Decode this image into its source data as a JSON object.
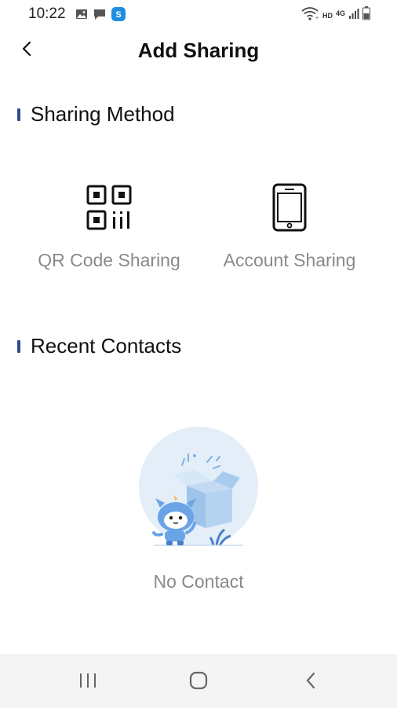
{
  "status_bar": {
    "time": "10:22",
    "left_icons": [
      "gallery-icon",
      "message-icon",
      "app-notification-icon"
    ],
    "right_icons": [
      "wifi-icon",
      "hd-icon",
      "signal-4g-icon",
      "battery-icon"
    ],
    "hd_label": "HD",
    "network_label": "4G"
  },
  "header": {
    "title": "Add Sharing",
    "back_icon": "chevron-left-icon"
  },
  "sharing_method": {
    "title": "Sharing Method",
    "options": [
      {
        "label": "QR Code Sharing",
        "icon": "qr-code-icon"
      },
      {
        "label": "Account Sharing",
        "icon": "phone-icon"
      }
    ]
  },
  "recent_contacts": {
    "title": "Recent Contacts",
    "empty_label": "No Contact",
    "illustration": "empty-box-mascot-illustration"
  },
  "nav_bar": {
    "buttons": [
      "recent-apps-icon",
      "home-icon",
      "back-icon"
    ]
  },
  "colors": {
    "accent": "#2e4c8a",
    "muted_text": "#8a8a8a",
    "illustration_bg": "#e3eef9",
    "illustration_blue": "#7fb0e3"
  }
}
